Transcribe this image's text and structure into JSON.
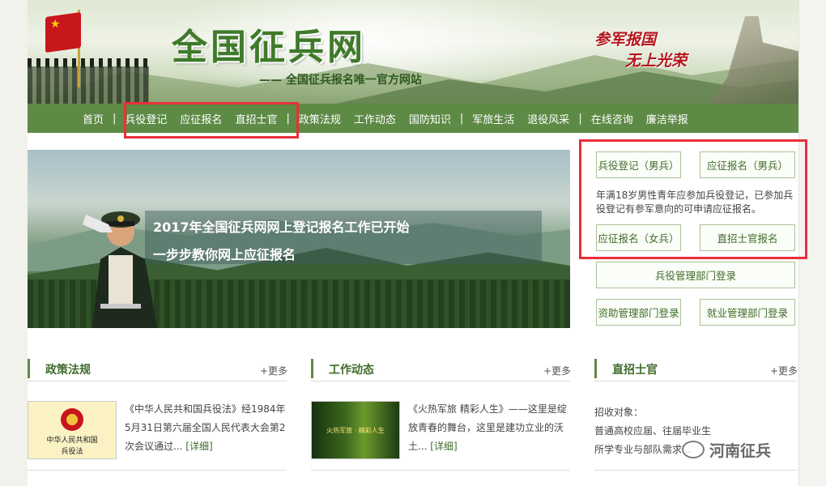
{
  "header": {
    "site_title": "全国征兵网",
    "site_subtitle": "—— 全国征兵报名唯一官方网站",
    "slogan_line1": "参军报国",
    "slogan_line2": "无上光荣"
  },
  "nav": {
    "items": [
      "首页",
      "兵役登记",
      "应征报名",
      "直招士官",
      "政策法规",
      "工作动态",
      "国防知识",
      "军旅生活",
      "退役风采",
      "在线咨询",
      "廉洁举报"
    ],
    "separator": "|"
  },
  "hero": {
    "line1": "2017年全国征兵网网上登记报名工作已开始",
    "line2": "一步步教你网上应征报名"
  },
  "side_panel": {
    "btn_register_male": "兵役登记（男兵）",
    "btn_apply_male": "应征报名（男兵）",
    "note": "年满18岁男性青年应参加兵役登记，已参加兵役登记有参军意向的可申请应征报名。",
    "btn_apply_female": "应征报名（女兵）",
    "btn_nco": "直招士官报名",
    "btn_military_admin_login": "兵役管理部门登录",
    "btn_aid_admin_login": "资助管理部门登录",
    "btn_employment_admin_login": "就业管理部门登录"
  },
  "sections": {
    "policy": {
      "title": "政策法规",
      "more": "+更多",
      "thumb_line1": "中华人民共和国",
      "thumb_line2": "兵役法",
      "text": "《中华人民共和国兵役法》经1984年5月31日第六届全国人民代表大会第2次会议通过...",
      "detail": "[详细]"
    },
    "work": {
      "title": "工作动态",
      "more": "+更多",
      "thumb_text": "火热军旅 · 精彩人生",
      "text": "《火热军旅 精彩人生》——这里是绽放青春的舞台，这里是建功立业的沃土...",
      "detail": "[详细]"
    },
    "nco": {
      "title": "直招士官",
      "more": "+更多",
      "line1": "招收对象：",
      "line2": "普通高校应届、往届毕业生",
      "line3": "所学专业与部队需求..."
    }
  },
  "watermark": {
    "text": "河南征兵"
  },
  "colors": {
    "nav_green": "#5d8a45",
    "title_green": "#3f7a2a",
    "slogan_red": "#b5141b",
    "highlight_red": "#e8303a"
  }
}
